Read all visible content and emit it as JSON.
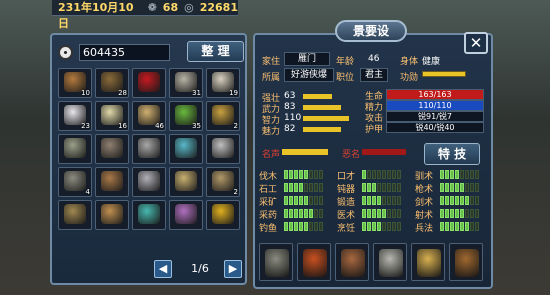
{
  "topbar": {
    "date": "231年10月10日",
    "stamina": "68",
    "coins": "22681"
  },
  "bag": {
    "money": "604435",
    "sort_label": "整 理",
    "page": "1/6",
    "slots": [
      {
        "count": "10",
        "icon": "jar",
        "color": "#b47a3e"
      },
      {
        "count": "28",
        "icon": "food-bowl",
        "color": "#8a6a3a"
      },
      {
        "count": "",
        "icon": "cherries",
        "color": "#c41a20"
      },
      {
        "count": "31",
        "icon": "bottle",
        "color": "#b8b4a6"
      },
      {
        "count": "19",
        "icon": "wine-jar",
        "color": "#d8d0c0"
      },
      {
        "count": "23",
        "icon": "salt",
        "color": "#e8e6ec"
      },
      {
        "count": "16",
        "icon": "garlic",
        "color": "#e0d8a8"
      },
      {
        "count": "46",
        "icon": "onions",
        "color": "#d0b070"
      },
      {
        "count": "35",
        "icon": "leek",
        "color": "#6ab83e"
      },
      {
        "count": "2",
        "icon": "grain",
        "color": "#c8a040"
      },
      {
        "count": "",
        "icon": "axe",
        "color": "#9aa088"
      },
      {
        "count": "",
        "icon": "flail",
        "color": "#908070"
      },
      {
        "count": "",
        "icon": "spear",
        "color": "#a8a8a8"
      },
      {
        "count": "",
        "icon": "sickle",
        "color": "#58b8c8"
      },
      {
        "count": "",
        "icon": "sword",
        "color": "#c0c0c0"
      },
      {
        "count": "4",
        "icon": "battle-axe",
        "color": "#8c8c80"
      },
      {
        "count": "",
        "icon": "bow",
        "color": "#a87848"
      },
      {
        "count": "",
        "icon": "halberd",
        "color": "#b0b0b8"
      },
      {
        "count": "",
        "icon": "dagger",
        "color": "#c8b070"
      },
      {
        "count": "2",
        "icon": "blade",
        "color": "#b09868"
      },
      {
        "count": "",
        "icon": "whip",
        "color": "#a08850"
      },
      {
        "count": "",
        "icon": "tiger-pelt",
        "color": "#c09050"
      },
      {
        "count": "",
        "icon": "necklace",
        "color": "#48b8b0"
      },
      {
        "count": "",
        "icon": "pendant",
        "color": "#b070c0"
      },
      {
        "count": "",
        "icon": "gold-ring",
        "color": "#e0b020"
      }
    ]
  },
  "character": {
    "name": "景要设",
    "home_label": "家住",
    "home": "雁门",
    "age_label": "年龄",
    "age": "46",
    "body_label": "身体",
    "body": "健康",
    "affiliation_label": "所属",
    "affiliation": "好游侠爆",
    "rank_label": "职位",
    "rank": "君主",
    "merit_label": "功勋",
    "stats": [
      {
        "label": "强壮",
        "value": "63",
        "fill": 0.63
      },
      {
        "label": "武力",
        "value": "83",
        "fill": 0.83
      },
      {
        "label": "智力",
        "value": "110",
        "fill": 1.0
      },
      {
        "label": "魅力",
        "value": "82",
        "fill": 0.82
      }
    ],
    "vitals": [
      {
        "label": "生命",
        "value": "163/163",
        "color": "#c01a1a"
      },
      {
        "label": "精力",
        "value": "110/110",
        "color": "#1a4ac0"
      },
      {
        "label": "攻击",
        "value": "锐91/锐7",
        "color": "#0d1622"
      },
      {
        "label": "护甲",
        "value": "锐40/锐40",
        "color": "#0d1622"
      }
    ],
    "fame_label": "名声",
    "infamy_label": "恶名",
    "special_label": "特 技",
    "skills": [
      {
        "name": "伐木",
        "level": 5
      },
      {
        "name": "口才",
        "level": 1
      },
      {
        "name": "驯术",
        "level": 4
      },
      {
        "name": "石工",
        "level": 4
      },
      {
        "name": "钝器",
        "level": 3
      },
      {
        "name": "枪术",
        "level": 5
      },
      {
        "name": "采矿",
        "level": 5
      },
      {
        "name": "锻造",
        "level": 4
      },
      {
        "name": "剑术",
        "level": 6
      },
      {
        "name": "采药",
        "level": 6
      },
      {
        "name": "医术",
        "level": 5
      },
      {
        "name": "射术",
        "level": 5
      },
      {
        "name": "钓鱼",
        "level": 5
      },
      {
        "name": "烹饪",
        "level": 4
      },
      {
        "name": "兵法",
        "level": 6
      }
    ],
    "equipment": [
      {
        "icon": "armor",
        "color": "#8a8a80"
      },
      {
        "icon": "curved-sword",
        "color": "#c85020"
      },
      {
        "icon": "mace",
        "color": "#a86840"
      },
      {
        "icon": "helmet",
        "color": "#b8b8b0"
      },
      {
        "icon": "scroll",
        "color": "#d8b050"
      },
      {
        "icon": "horse",
        "color": "#a06830"
      }
    ]
  }
}
